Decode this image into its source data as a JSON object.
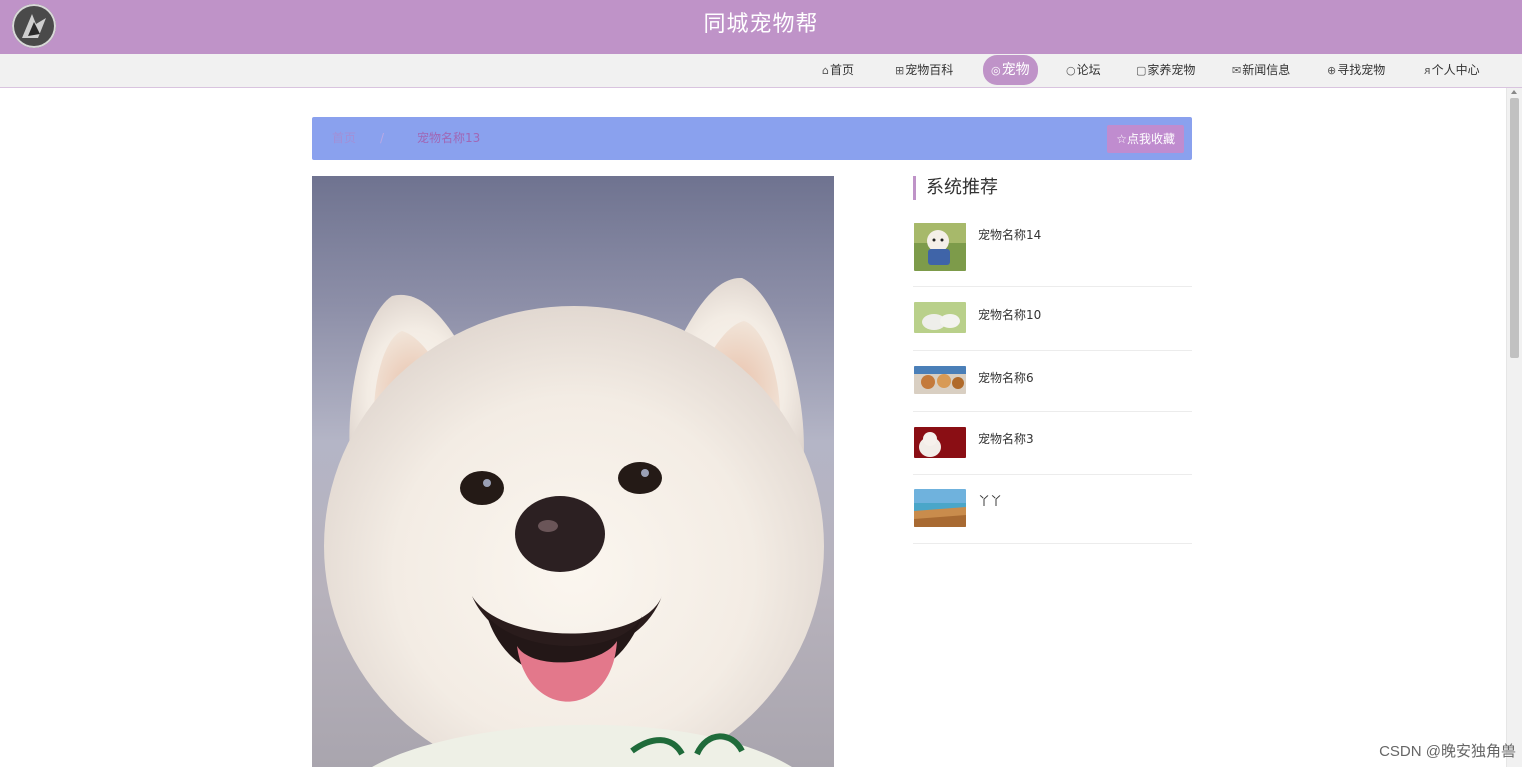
{
  "header": {
    "site_title": "同城宠物帮",
    "logo_icon": "avatar-logo"
  },
  "nav": {
    "items": [
      {
        "icon": "home-icon",
        "glyph": "⌂",
        "label": "首页"
      },
      {
        "icon": "book-icon",
        "glyph": "⊞",
        "label": "宠物百科"
      },
      {
        "icon": "paw-icon",
        "glyph": "◎",
        "label": "宠物",
        "active": true
      },
      {
        "icon": "chat-icon",
        "glyph": "○",
        "label": "论坛"
      },
      {
        "icon": "doc-icon",
        "glyph": "▢",
        "label": "家养宠物"
      },
      {
        "icon": "mail-icon",
        "glyph": "✉",
        "label": "新闻信息"
      },
      {
        "icon": "search-pet-icon",
        "glyph": "⊕",
        "label": "寻找宠物"
      },
      {
        "icon": "user-icon",
        "glyph": "ᴙ",
        "label": "个人中心"
      }
    ],
    "active_color": "#bf93c8"
  },
  "breadcrumb": {
    "home": "首页",
    "separator": "/",
    "current": "宠物名称13"
  },
  "favorite_button": {
    "icon": "star-outline-icon",
    "glyph": "☆",
    "label": "点我收藏"
  },
  "recommend": {
    "title": "系统推荐",
    "items": [
      {
        "name": "宠物名称14",
        "thumb": "white-poodle-in-blue-shirt"
      },
      {
        "name": "宠物名称10",
        "thumb": "white-dogs-on-grass"
      },
      {
        "name": "宠物名称6",
        "thumb": "toy-puppies-on-shelf"
      },
      {
        "name": "宠物名称3",
        "thumb": "white-dog-red-background"
      },
      {
        "name": "丫丫",
        "thumb": "beach-coastline"
      }
    ]
  },
  "watermark": "CSDN @晚安独角兽",
  "colors": {
    "header": "#bf93c8",
    "breadcrumb_bar": "#8aa1ee",
    "favorite_button": "#c08ccf"
  }
}
